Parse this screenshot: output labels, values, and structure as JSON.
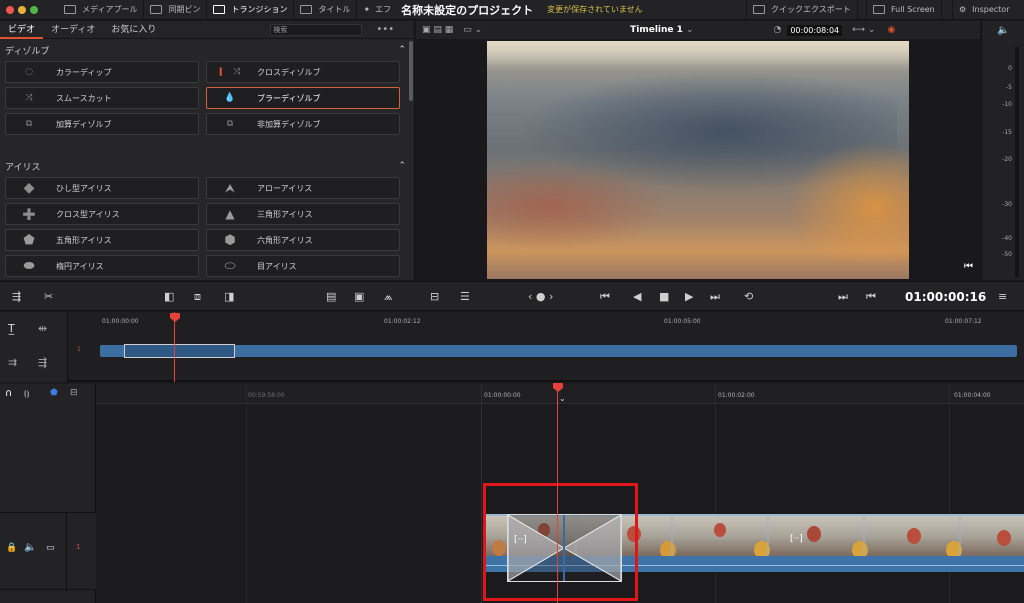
{
  "topbar": {
    "items": [
      "メディアプール",
      "同期ビン",
      "トランジション",
      "タイトル",
      "エフ"
    ],
    "project_title": "名称未設定のプロジェクト",
    "unsaved": "変更が保存されていません",
    "right_items": [
      "クイックエクスポート",
      "Full Screen",
      "Inspector"
    ]
  },
  "effects": {
    "tabs": [
      "ビデオ",
      "オーディオ",
      "お気に入り"
    ],
    "search_placeholder": "検索",
    "more": "•••",
    "sections": [
      {
        "title": "ディゾルブ",
        "items": [
          {
            "label": "カラーディップ",
            "icon": "dip-icon"
          },
          {
            "label": "クロスディゾルブ",
            "icon": "cross-dissolve-icon"
          },
          {
            "label": "スムースカット",
            "icon": "smooth-cut-icon"
          },
          {
            "label": "ブラーディゾルブ",
            "icon": "blur-dissolve-icon"
          },
          {
            "label": "加算ディゾルブ",
            "icon": "additive-icon"
          },
          {
            "label": "非加算ディゾルブ",
            "icon": "non-additive-icon"
          }
        ]
      },
      {
        "title": "アイリス",
        "items": [
          {
            "label": "ひし型アイリス",
            "icon": "diamond-icon"
          },
          {
            "label": "アローアイリス",
            "icon": "arrow-icon"
          },
          {
            "label": "クロス型アイリス",
            "icon": "cross-icon"
          },
          {
            "label": "三角形アイリス",
            "icon": "triangle-icon"
          },
          {
            "label": "五角形アイリス",
            "icon": "pentagon-icon"
          },
          {
            "label": "六角形アイリス",
            "icon": "hexagon-icon"
          },
          {
            "label": "楕円アイリス",
            "icon": "oval-icon"
          },
          {
            "label": "目アイリス",
            "icon": "eye-icon"
          }
        ]
      }
    ]
  },
  "viewer": {
    "timeline_name": "Timeline 1",
    "timecode": "00:00:08:04"
  },
  "meter": {
    "labels": [
      "0",
      "-5",
      "-10",
      "-15",
      "-20",
      "-30",
      "-40",
      "-50"
    ]
  },
  "controls": {
    "timecode": "01:00:00:16"
  },
  "upper_timeline": {
    "ticks": [
      "01:00:00:00",
      "01:00:02:12",
      "01:00:05:00",
      "01:00:07:12"
    ],
    "track_number": "1"
  },
  "lower_timeline": {
    "ticks": [
      "00:59:58:00",
      "01:00:00:00",
      "01:00:02:00",
      "01:00:04:00"
    ],
    "track_number": "1",
    "transition_label": "[··]",
    "clip_label": "[··]"
  },
  "colors": {
    "accent": "#e0522d",
    "playhead": "#e5423a",
    "highlight_box": "#e0161b",
    "clip_blue": "#3d6ea1",
    "unsaved_text": "#d8c14a"
  }
}
